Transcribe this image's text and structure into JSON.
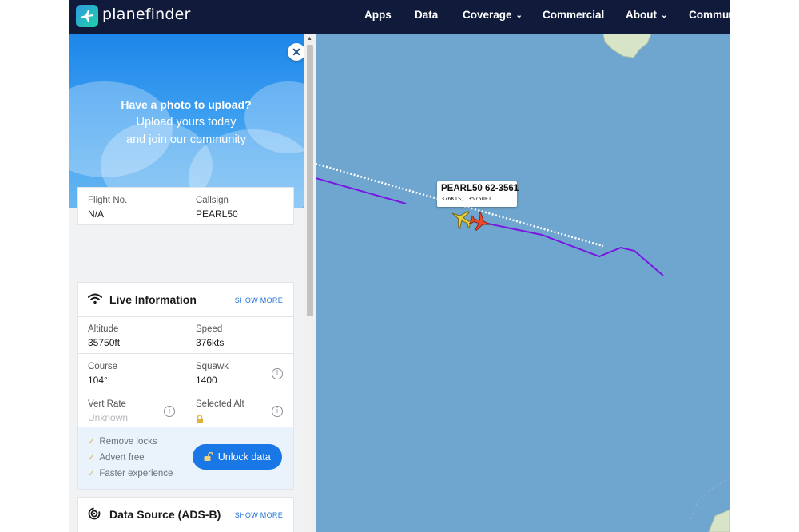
{
  "brand": {
    "name": "planefinder"
  },
  "nav": [
    {
      "label": "Apps",
      "has_dropdown": false
    },
    {
      "label": "Data",
      "has_dropdown": false
    },
    {
      "label": "Coverage",
      "has_dropdown": true
    },
    {
      "label": "Commercial",
      "has_dropdown": false
    },
    {
      "label": "About",
      "has_dropdown": true
    },
    {
      "label": "Commun",
      "has_dropdown": false
    }
  ],
  "promo": {
    "title": "Have a photo to upload?",
    "line2": "Upload yours today",
    "line3": "and join our community",
    "close_icon": "close-icon"
  },
  "flight": {
    "flight_no_label": "Flight No.",
    "flight_no": "N/A",
    "callsign_label": "Callsign",
    "callsign": "PEARL50"
  },
  "live": {
    "title": "Live Information",
    "show_more": "SHOW MORE",
    "icon": "wifi-icon",
    "altitude_label": "Altitude",
    "altitude": "35750ft",
    "speed_label": "Speed",
    "speed": "376kts",
    "course_label": "Course",
    "course": "104°",
    "squawk_label": "Squawk",
    "squawk": "1400",
    "vert_rate_label": "Vert Rate",
    "vert_rate": "Unknown",
    "selected_alt_label": "Selected Alt",
    "locked_icon": "lock-icon",
    "info_icon": "i"
  },
  "upsell": {
    "items": [
      "Remove locks",
      "Advert free",
      "Faster experience"
    ],
    "button": "Unlock data",
    "button_icon": "unlock-icon"
  },
  "source": {
    "title": "Data Source (ADS-B)",
    "show_more": "SHOW MORE",
    "icon": "signal-icon"
  },
  "map": {
    "label_callsign": "PEARL50 62-3561",
    "label_sub": "376KTS, 35750FT",
    "colors": {
      "sea": "#6fa6cf",
      "track": "#7a17e0",
      "land": "#d8e4c8"
    }
  }
}
